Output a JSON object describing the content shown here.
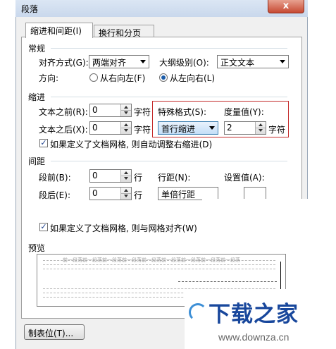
{
  "dialog": {
    "title": "段落",
    "close_glyph": "x"
  },
  "tabs": [
    {
      "label": "缩进和间距(I)",
      "active": true
    },
    {
      "label": "换行和分页(P)",
      "active": false
    }
  ],
  "general": {
    "section_title": "常规",
    "alignment_label": "对齐方式(G):",
    "alignment_value": "两端对齐",
    "outline_label": "大纲级别(O):",
    "outline_value": "正文文本",
    "direction_label": "方向:",
    "rtl_label": "从右向左(F)",
    "ltr_label": "从左向右(L)",
    "direction_selected": "ltr"
  },
  "indent": {
    "section_title": "缩进",
    "before_label": "文本之前(R):",
    "before_value": "0",
    "before_unit": "字符",
    "after_label": "文本之后(X):",
    "after_value": "0",
    "after_unit": "字符",
    "special_label": "特殊格式(S):",
    "special_value": "首行缩进",
    "measure_label": "度量值(Y):",
    "measure_value": "2",
    "measure_unit": "字符",
    "grid_checkbox_label": "如果定义了文档网格, 则自动调整右缩进(D)",
    "grid_checkbox_checked": true
  },
  "spacing": {
    "section_title": "间距",
    "before_label": "段前(B):",
    "before_value": "0",
    "before_unit": "行",
    "after_label": "段后(E):",
    "after_value": "0",
    "after_unit": "行",
    "line_label": "行距(N):",
    "line_value": "单倍行距",
    "setting_label": "设置值(A):",
    "grid_checkbox_label": "如果定义了文档网格, 则与网格对齐(W)",
    "grid_checkbox_checked": true
  },
  "preview": {
    "section_title": "预览",
    "sample_text": "前一段落前一段落前一段落前一段落前一段落前一段落前一段落前一段落前一段落"
  },
  "footer": {
    "tab_button": "制表位(T)..."
  },
  "watermark": {
    "title": "下载之家",
    "url": "www.downza.cn"
  },
  "colors": {
    "highlight_box": "#c42b2b",
    "accent": "#1b5ca8",
    "watermark_blue": "#18479c"
  }
}
